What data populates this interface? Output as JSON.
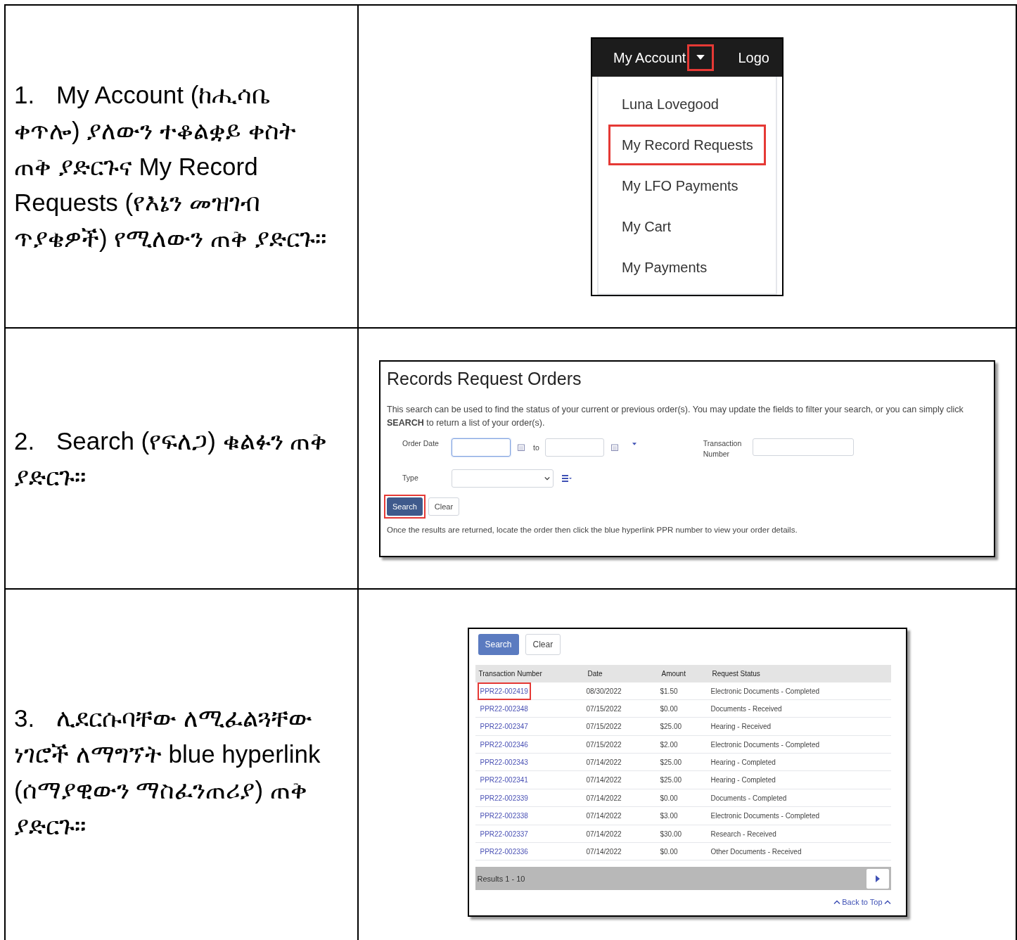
{
  "steps": [
    {
      "number": "1.",
      "text": "My Account (ከሒሳቤ ቀጥሎ) ያለውን ተቆልቋይ ቀስት ጠቅ ያድርጉና My Record Requests (የእኔን መዝገብ ጥያቄዎች) የሚለውን ጠቅ ያድርጉ።",
      "panel": {
        "kind": "menu",
        "menu_label": "My Account",
        "caret_highlighted": true,
        "cut_link": "Logo",
        "items": [
          {
            "label": "Luna Lovegood",
            "highlighted": false
          },
          {
            "label": "My Record Requests",
            "highlighted": true
          },
          {
            "label": "My LFO Payments",
            "highlighted": false
          },
          {
            "label": "My Cart",
            "highlighted": false
          },
          {
            "label": "My Payments",
            "highlighted": false
          }
        ]
      }
    },
    {
      "number": "2.",
      "text": "Search (የፍለጋ) ቁልፉን ጠቅ ያድርጉ።",
      "panel": {
        "kind": "search_form",
        "title": "Records Request Orders",
        "description": "This search can be used to find the status of your current or previous order(s). You may update the fields to filter your search, or you can simply click **SEARCH** to return a list of your order(s).",
        "order_date_label": "Order Date",
        "to_label": "to",
        "date_from_focused": true,
        "transaction_label": "Transaction Number",
        "type_label": "Type",
        "buttons": [
          {
            "label": "Search",
            "kind": "primary",
            "highlighted": true
          },
          {
            "label": "Clear",
            "kind": "secondary",
            "highlighted": false
          }
        ],
        "note": "Once the results are returned, locate the order then click the blue hyperlink PPR number to view your order details."
      }
    },
    {
      "number": "3.",
      "text": "ሊደርሱባቸው ለሚፈልጓቸው ነገሮች ለማግኘት blue hyperlink (ሰማያዊውን ማስፈንጠሪያ) ጠቅ ያድርጉ።",
      "panel": {
        "kind": "results",
        "buttons": [
          {
            "label": "Search",
            "kind": "primary",
            "highlighted": false
          },
          {
            "label": "Clear",
            "kind": "secondary",
            "highlighted": false
          }
        ],
        "columns": [
          "Transaction Number",
          "Date",
          "Amount",
          "Request Status"
        ],
        "rows": [
          {
            "transaction": "PPR22-002419",
            "date": "08/30/2022",
            "amount": "$1.50",
            "status": "Electronic Documents - Completed",
            "highlighted": true
          },
          {
            "transaction": "PPR22-002348",
            "date": "07/15/2022",
            "amount": "$0.00",
            "status": "Documents - Received",
            "highlighted": false
          },
          {
            "transaction": "PPR22-002347",
            "date": "07/15/2022",
            "amount": "$25.00",
            "status": "Hearing - Received",
            "highlighted": false
          },
          {
            "transaction": "PPR22-002346",
            "date": "07/15/2022",
            "amount": "$2.00",
            "status": "Electronic Documents - Completed",
            "highlighted": false
          },
          {
            "transaction": "PPR22-002343",
            "date": "07/14/2022",
            "amount": "$25.00",
            "status": "Hearing - Completed",
            "highlighted": false
          },
          {
            "transaction": "PPR22-002341",
            "date": "07/14/2022",
            "amount": "$25.00",
            "status": "Hearing - Completed",
            "highlighted": false
          },
          {
            "transaction": "PPR22-002339",
            "date": "07/14/2022",
            "amount": "$0.00",
            "status": "Documents - Completed",
            "highlighted": false
          },
          {
            "transaction": "PPR22-002338",
            "date": "07/14/2022",
            "amount": "$3.00",
            "status": "Electronic Documents - Completed",
            "highlighted": false
          },
          {
            "transaction": "PPR22-002337",
            "date": "07/14/2022",
            "amount": "$30.00",
            "status": "Research - Received",
            "highlighted": false
          },
          {
            "transaction": "PPR22-002336",
            "date": "07/14/2022",
            "amount": "$0.00",
            "status": "Other Documents - Received",
            "highlighted": false
          }
        ],
        "results_label": "Results 1 - 10",
        "back_to_top": "Back to Top"
      }
    }
  ]
}
